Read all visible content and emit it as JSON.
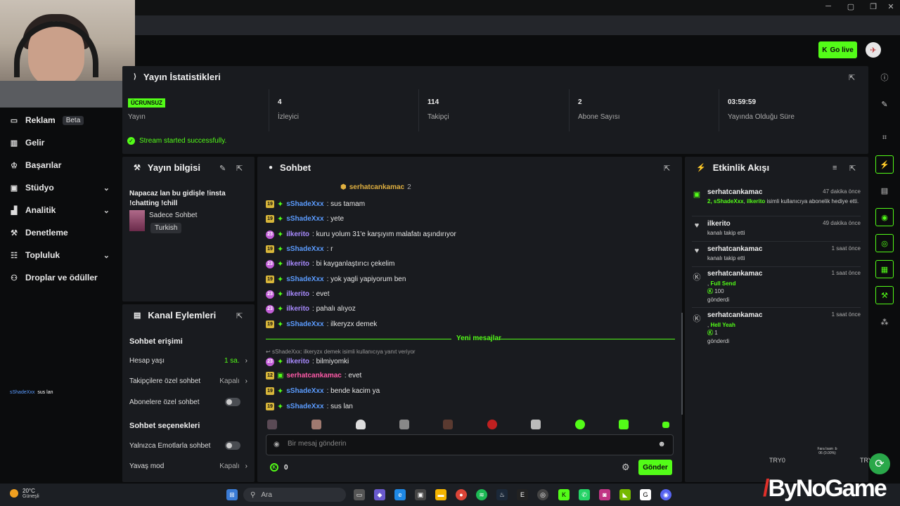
{
  "topbar": {
    "go_live_label": "Go live"
  },
  "sidebar": {
    "items": [
      {
        "label": "Reklam",
        "badge": "Beta",
        "icon": "ad-icon"
      },
      {
        "label": "Gelir",
        "icon": "revenue-icon"
      },
      {
        "label": "Başarılar",
        "icon": "trophy-icon"
      },
      {
        "label": "Stüdyo",
        "icon": "studio-icon"
      },
      {
        "label": "Analitik",
        "icon": "analytics-icon"
      },
      {
        "label": "Denetleme",
        "icon": "moderation-icon"
      },
      {
        "label": "Topluluk",
        "icon": "community-icon"
      },
      {
        "label": "Droplar ve ödüller",
        "icon": "drops-icon"
      }
    ],
    "overlay_chat": {
      "user": "sShadeXxx",
      "text": "sus lan"
    }
  },
  "stats": {
    "title": "Yayın İstatistikleri",
    "tag": "ÜCRUNSUZ",
    "items": [
      {
        "value": "",
        "label": "Yayın"
      },
      {
        "value": "4",
        "label": "İzleyici"
      },
      {
        "value": "114",
        "label": "Takipçi"
      },
      {
        "value": "2",
        "label": "Abone Sayısı"
      },
      {
        "value": "03:59:59",
        "label": "Yayında Olduğu Süre"
      }
    ],
    "success": "Stream started successfully."
  },
  "info": {
    "title": "Yayın bilgisi",
    "stream_title": "Napacaz lan bu gidişle !insta !chatting !chill",
    "category": "Sadece Sohbet",
    "language": "Turkish"
  },
  "actions": {
    "title": "Kanal Eylemleri",
    "section1": "Sohbet erişimi",
    "account_age": {
      "label": "Hesap yaşı",
      "value": "1 sa."
    },
    "followers_chat": {
      "label": "Takipçilere özel sohbet",
      "value": "Kapalı"
    },
    "subs_chat": {
      "label": "Abonelere özel sohbet"
    },
    "section2": "Sohbet seçenekleri",
    "emote_only": {
      "label": "Yalnızca Emotlarla sohbet"
    },
    "slow_mode": {
      "label": "Yavaş mod",
      "value": "Kapalı"
    }
  },
  "chat": {
    "title": "Sohbet",
    "pinned": {
      "user": "serhatcankamac",
      "count": "2"
    },
    "messages": [
      {
        "badge": "19",
        "user": "sShadeXxx",
        "text": ": sus tamam"
      },
      {
        "badge": "19",
        "user": "sShadeXxx",
        "text": ": yete"
      },
      {
        "badge": "23",
        "user": "ilkerito",
        "text": ": kuru yolum 31'e karşıyım malafatı aşındırıyor"
      },
      {
        "badge": "19",
        "user": "sShadeXxx",
        "text": ": r"
      },
      {
        "badge": "23",
        "user": "ilkerito",
        "text": ": bi kayganlaştırıcı çekelim"
      },
      {
        "badge": "19",
        "user": "sShadeXxx",
        "text": ": yok yagli yapiyorum ben"
      },
      {
        "badge": "23",
        "user": "ilkerito",
        "text": ": evet"
      },
      {
        "badge": "23",
        "user": "ilkerito",
        "text": ": pahalı alıyoz"
      },
      {
        "badge": "19",
        "user": "sShadeXxx",
        "text": ": ilkeryzx demek"
      }
    ],
    "new_messages_label": "Yeni mesajlar",
    "reply_line": "sShadeXxx: ilkeryzx demek isimli kullanıcıya yanıt veriyor",
    "new_messages": [
      {
        "badge": "23",
        "user": "ilkerito",
        "text": ": bilmiyomki"
      },
      {
        "badge": "12",
        "user": "serhatcankamac",
        "text": ": evet"
      },
      {
        "badge": "19",
        "user": "sShadeXxx",
        "text": ": bende kacim ya"
      },
      {
        "badge": "19",
        "user": "sShadeXxx",
        "text": ": sus lan"
      }
    ],
    "input_placeholder": "Bir mesaj gönderin",
    "points": "0",
    "send_label": "Gönder"
  },
  "events": {
    "title": "Etkinlik Akışı",
    "items": [
      {
        "icon": "gift-icon",
        "user": "serhatcankamac",
        "time": "47 dakika önce",
        "desc_pre": "2, ",
        "desc_g1": "sShadeXxx",
        "desc_mid": ", ",
        "desc_g2": "ilkerito",
        "desc_post": " isimli kullanıcıya abonelik hediye etti."
      },
      {
        "icon": "heart-icon",
        "user": "ilkerito",
        "time": "49 dakika önce",
        "desc": "kanalı takip etti"
      },
      {
        "icon": "heart-icon",
        "user": "serhatcankamac",
        "time": "1 saat önce",
        "desc": "kanalı takip etti"
      },
      {
        "icon": "kick-icon",
        "user": "serhatcankamac",
        "time": "1 saat önce",
        "item": "Full Send",
        "amount": "100",
        "desc": "gönderdi"
      },
      {
        "icon": "kick-icon",
        "user": "serhatcankamac",
        "time": "1 saat önce",
        "item": "Hell Yeah",
        "amount": "1",
        "desc": "gönderdi"
      }
    ]
  },
  "overlay": {
    "perf_line1": "Fara Isam :b",
    "perf_line2": "06 (0.00%)",
    "try0": "TRY0",
    "try1": "TRY0"
  },
  "taskbar": {
    "temp": "20°C",
    "weather": "Güneşli",
    "search_placeholder": "Ara"
  },
  "watermark": {
    "brand": "ByNoGame"
  },
  "colors": {
    "accent": "#53fc18",
    "bg": "#0b0c0d",
    "panel": "#191b1f"
  }
}
